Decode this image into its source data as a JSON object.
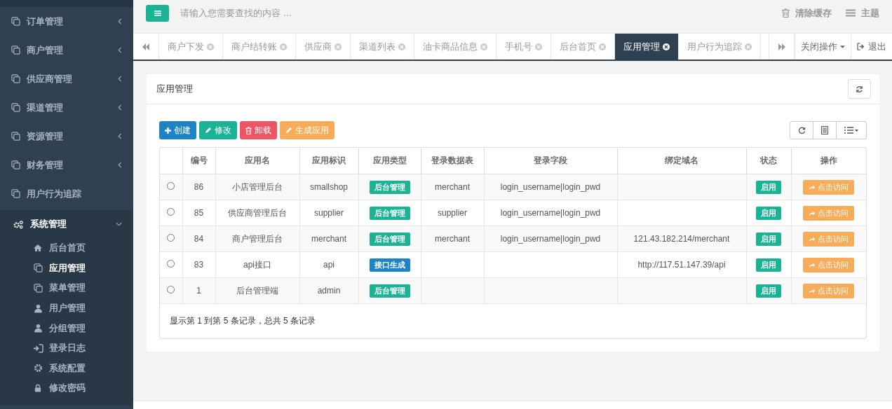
{
  "sidebar": {
    "items": [
      {
        "label": "订单管理",
        "kind": "group",
        "expanded": false
      },
      {
        "label": "商户管理",
        "kind": "group",
        "expanded": false
      },
      {
        "label": "供应商管理",
        "kind": "group",
        "expanded": false
      },
      {
        "label": "渠道管理",
        "kind": "group",
        "expanded": false
      },
      {
        "label": "资源管理",
        "kind": "group",
        "expanded": false
      },
      {
        "label": "财务管理",
        "kind": "group",
        "expanded": false
      },
      {
        "label": "用户行为追踪",
        "kind": "link"
      },
      {
        "label": "系统管理",
        "kind": "group",
        "expanded": true,
        "children": [
          {
            "label": "后台首页",
            "selected": false
          },
          {
            "label": "应用管理",
            "selected": true
          },
          {
            "label": "菜单管理",
            "selected": false
          },
          {
            "label": "用户管理",
            "selected": false
          },
          {
            "label": "分组管理",
            "selected": false
          },
          {
            "label": "登录日志",
            "selected": false
          },
          {
            "label": "系统配置",
            "selected": false
          },
          {
            "label": "修改密码",
            "selected": false
          }
        ]
      }
    ]
  },
  "topbar": {
    "search": {
      "placeholder": "请输入您需要查找的内容 …"
    },
    "actions": [
      "清除缓存",
      "主题"
    ]
  },
  "tabs": [
    {
      "label": "商户下发",
      "selected": false
    },
    {
      "label": "商户结转账",
      "selected": false
    },
    {
      "label": "供应商",
      "selected": false
    },
    {
      "label": "渠道列表",
      "selected": false
    },
    {
      "label": "油卡商品信息",
      "selected": false
    },
    {
      "label": "手机号",
      "selected": false
    },
    {
      "label": "后台首页",
      "selected": false
    },
    {
      "label": "应用管理",
      "selected": true
    },
    {
      "label": "用户行为追踪",
      "selected": false
    }
  ],
  "tab_tools": {
    "close_menu": "关闭操作",
    "logout": "退出"
  },
  "panel": {
    "title": "应用管理",
    "toolbar": [
      {
        "label": "创建",
        "color": "#1c84c6"
      },
      {
        "label": "修改",
        "color": "#1ab394"
      },
      {
        "label": "卸载",
        "color": "#ed5565"
      },
      {
        "label": "生成应用",
        "color": "#f8ac59"
      }
    ],
    "table": {
      "columns": [
        "编号",
        "应用名",
        "应用标识",
        "应用类型",
        "登录数据表",
        "登录字段",
        "绑定域名",
        "状态",
        "操作"
      ],
      "rows": [
        {
          "selected": false,
          "id": "86",
          "name": "小店管理后台",
          "key": "smallshop",
          "type": {
            "label": "后台管理",
            "color": "#1ab394"
          },
          "login_table": "merchant",
          "login_fields": "login_username|login_pwd",
          "domain": "",
          "status": "启用",
          "action": "点击访问"
        },
        {
          "selected": false,
          "id": "85",
          "name": "供应商管理后台",
          "key": "supplier",
          "type": {
            "label": "后台管理",
            "color": "#1ab394"
          },
          "login_table": "supplier",
          "login_fields": "login_username|login_pwd",
          "domain": "",
          "status": "启用",
          "action": "点击访问"
        },
        {
          "selected": false,
          "id": "84",
          "name": "商户管理后台",
          "key": "merchant",
          "type": {
            "label": "后台管理",
            "color": "#1ab394"
          },
          "login_table": "merchant",
          "login_fields": "login_username|login_pwd",
          "domain": "121.43.182.214/merchant",
          "status": "启用",
          "action": "点击访问"
        },
        {
          "selected": false,
          "id": "83",
          "name": "api接口",
          "key": "api",
          "type": {
            "label": "接口生成",
            "color": "#1c84c6"
          },
          "login_table": "",
          "login_fields": "",
          "domain": "http://117.51.147.39/api",
          "status": "启用",
          "action": "点击访问"
        },
        {
          "selected": false,
          "id": "1",
          "name": "后台管理端",
          "key": "admin",
          "type": {
            "label": "后台管理",
            "color": "#1ab394"
          },
          "login_table": "",
          "login_fields": "",
          "domain": "",
          "status": "启用",
          "action": "点击访问"
        }
      ],
      "footer": "显示第 1 到第 5 条记录，总共 5 条记录"
    }
  }
}
